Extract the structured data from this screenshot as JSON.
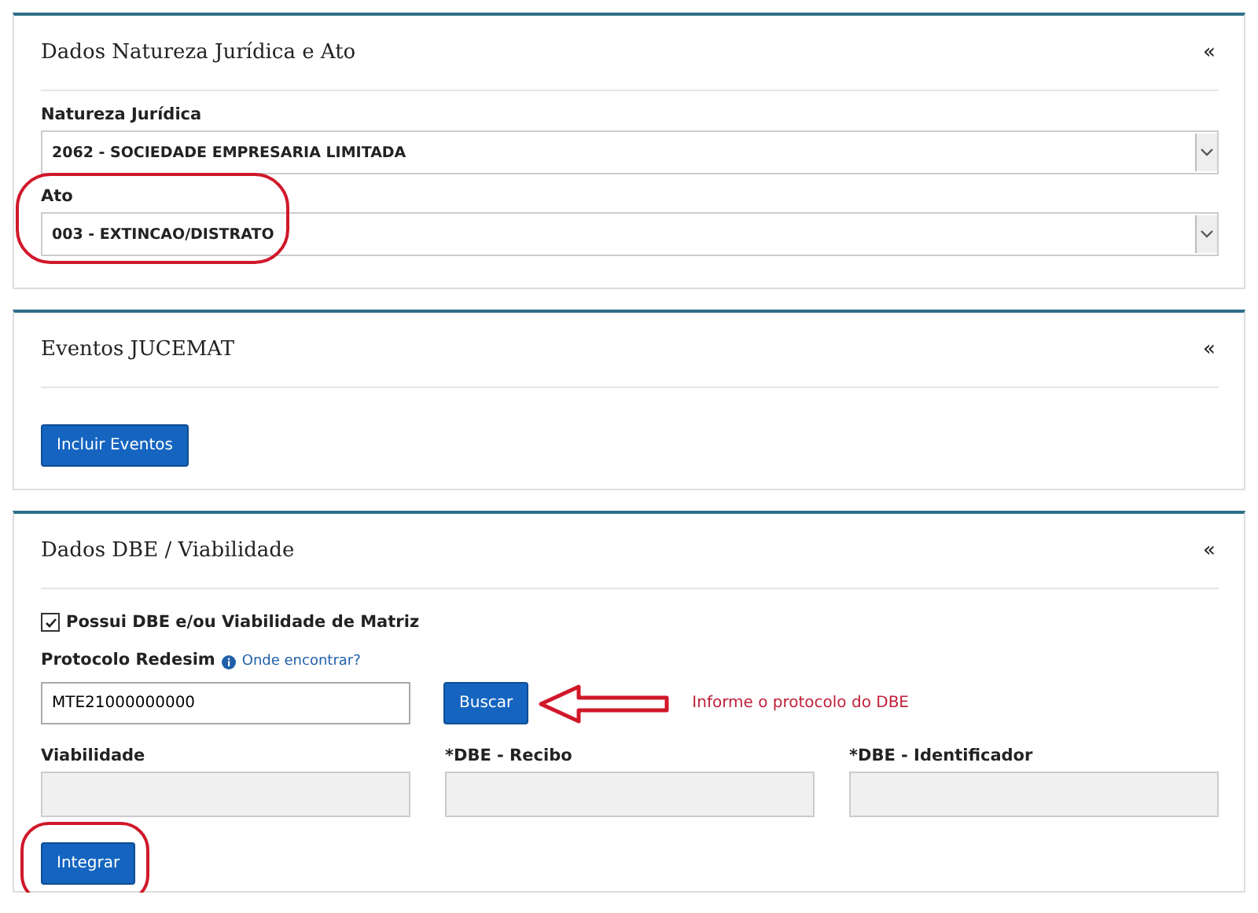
{
  "panels": [
    {
      "title": "Dados Natureza Jurídica e Ato",
      "toggle": "«",
      "items": [
        {
          "kind": "select",
          "label": "Natureza Jurídica",
          "value": "2062 - SOCIEDADE EMPRESARIA LIMITADA"
        },
        {
          "kind": "select",
          "label": "Ato",
          "value": "003 - EXTINCAO/DISTRATO",
          "circled": true
        }
      ]
    },
    {
      "title": "Eventos JUCEMAT",
      "toggle": "«",
      "items": [
        {
          "kind": "button",
          "label": "Incluir Eventos"
        }
      ]
    },
    {
      "title": "Dados DBE / Viabilidade",
      "toggle": "«",
      "items": [
        {
          "kind": "checkbox",
          "label": "Possui DBE e/ou Viabilidade de Matriz",
          "checked": true
        },
        {
          "kind": "search",
          "label": "Protocolo Redesim",
          "help": "Onde encontrar?",
          "value": "MTE21000000000",
          "button": "Buscar",
          "note": "Informe o protocolo do DBE"
        },
        {
          "kind": "readonly-row",
          "fields": [
            {
              "label": "Viabilidade"
            },
            {
              "label": "*DBE - Recibo"
            },
            {
              "label": "*DBE - Identificador"
            }
          ]
        },
        {
          "kind": "button",
          "label": "Integrar",
          "circled": true
        }
      ]
    }
  ]
}
